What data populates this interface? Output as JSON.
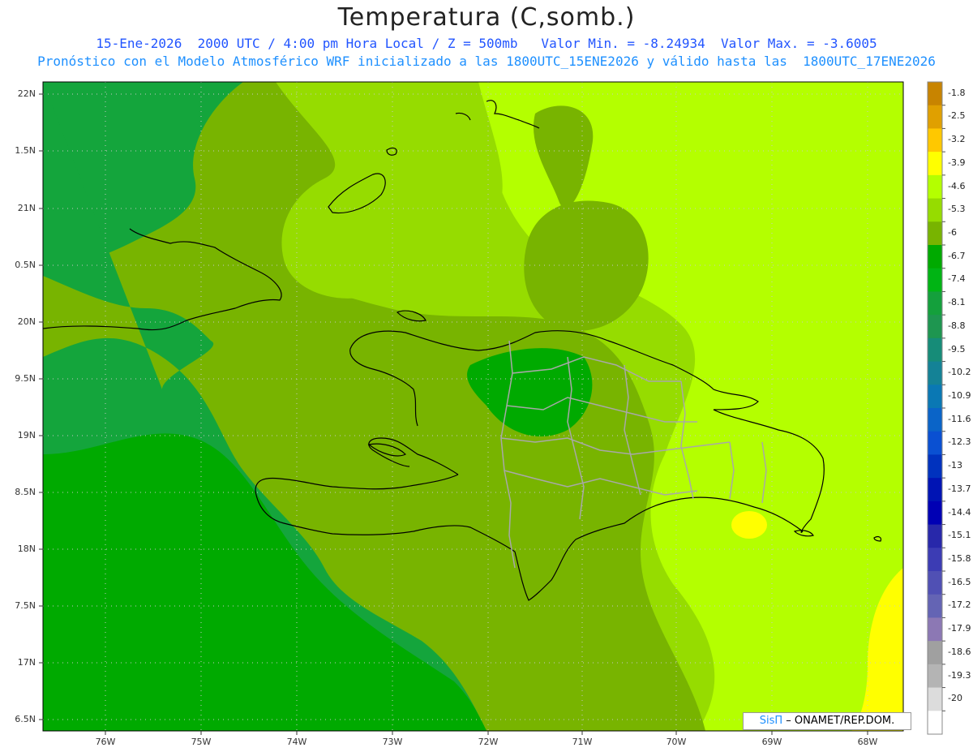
{
  "header": {
    "title": "Temperatura (C,somb.)",
    "line1": "15-Ene-2026  2000 UTC / 4:00 pm Hora Local / Z = 500mb   Valor Min. = -8.24934  Valor Max. = -3.6005",
    "line2": "Pronóstico con el Modelo Atmosférico WRF inicializado a las 1800UTC_15ENE2026 y válido hasta las  1800UTC_17ENE2026"
  },
  "axes": {
    "lat_labels": [
      "22N",
      "1.5N",
      "21N",
      "0.5N",
      "20N",
      "9.5N",
      "19N",
      "8.5N",
      "18N",
      "7.5N",
      "17N",
      "6.5N"
    ],
    "lon_labels": [
      "76W",
      "75W",
      "74W",
      "73W",
      "72W",
      "71W",
      "70W",
      "69W",
      "68W"
    ]
  },
  "colorbar": {
    "labels": [
      "-1.8",
      "-2.5",
      "-3.2",
      "-3.9",
      "-4.6",
      "-5.3",
      "-6",
      "-6.7",
      "-7.4",
      "-8.1",
      "-8.8",
      "-9.5",
      "-10.2",
      "-10.9",
      "-11.6",
      "-12.3",
      "-13",
      "-13.7",
      "-14.4",
      "-15.1",
      "-15.8",
      "-16.5",
      "-17.2",
      "-17.9",
      "-18.6",
      "-19.3",
      "-20"
    ],
    "colors": [
      "#c88400",
      "#e0a000",
      "#ffc800",
      "#ffff00",
      "#b4ff00",
      "#96dc00",
      "#78b400",
      "#00aa00",
      "#00b414",
      "#14a03c",
      "#1e9650",
      "#168c78",
      "#148296",
      "#0a78b4",
      "#0a64c8",
      "#0a50d2",
      "#0032be",
      "#0014b4",
      "#0000b4",
      "#2828aa",
      "#3c3cb4",
      "#5050b4",
      "#6464b4",
      "#8c78b4",
      "#a0a0a0",
      "#b4b4b4",
      "#dcdcdc",
      "#ffffff"
    ]
  },
  "credit": {
    "brand": "SisΠ",
    "text": " – ONAMET/REP.DOM."
  },
  "palette": {
    "dark_green": "#14a53c",
    "mid_green": "#37b21e",
    "olive_green": "#78b400",
    "light_green": "#96dc00",
    "yellow_green": "#b4ff00",
    "yellow": "#ffff00"
  }
}
